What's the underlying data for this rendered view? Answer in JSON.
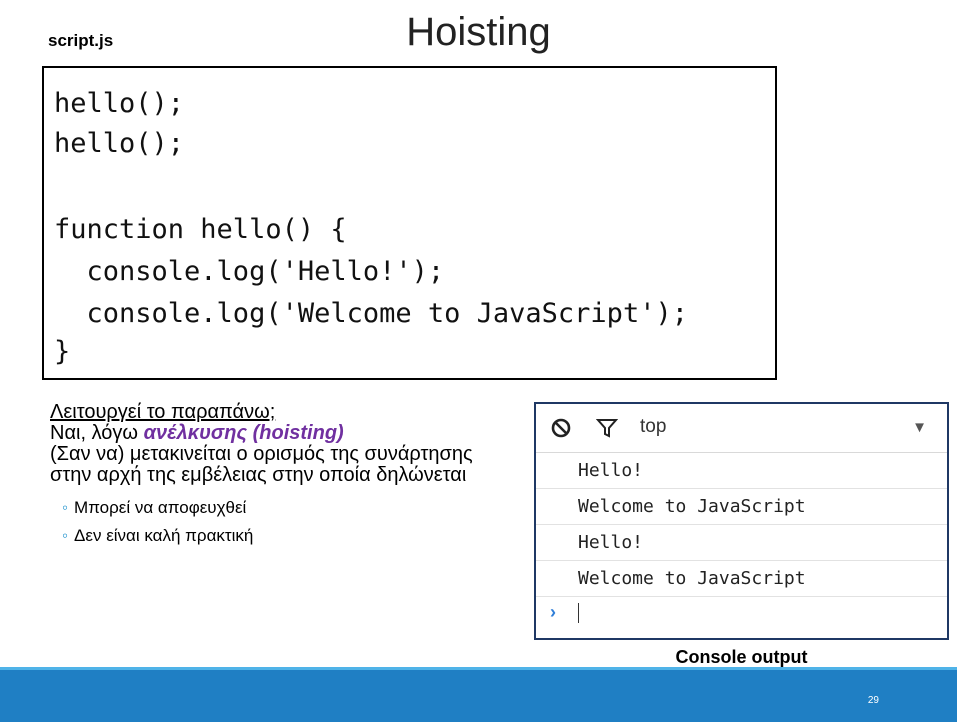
{
  "slide": {
    "file_label": "script.js",
    "title": "Hoisting",
    "code_lines": [
      "hello();",
      "hello();",
      "",
      "function hello() {",
      "  console.log('Hello!');",
      "  console.log('Welcome to JavaScript');",
      "}"
    ],
    "notes": {
      "question": "Λειτουργεί το παραπάνω;",
      "answer_prefix": "Ναι, λόγω ",
      "answer_highlight": "ανέλκυσης (hoisting)",
      "explanation": "(Σαν να) μετακινείται ο ορισμός της συνάρτησης στην αρχή της εμβέλειας στην οποία δηλώνεται",
      "bullets": [
        "Μπορεί να αποφευχθεί",
        "Δεν είναι καλή πρακτική"
      ]
    },
    "console": {
      "context_label": "top",
      "logs": [
        "Hello!",
        "Welcome to JavaScript",
        "Hello!",
        "Welcome to JavaScript"
      ],
      "caption": "Console output"
    },
    "page_number": "29",
    "colors": {
      "accent": "#1f7fc4",
      "highlight": "#7030a0"
    }
  }
}
